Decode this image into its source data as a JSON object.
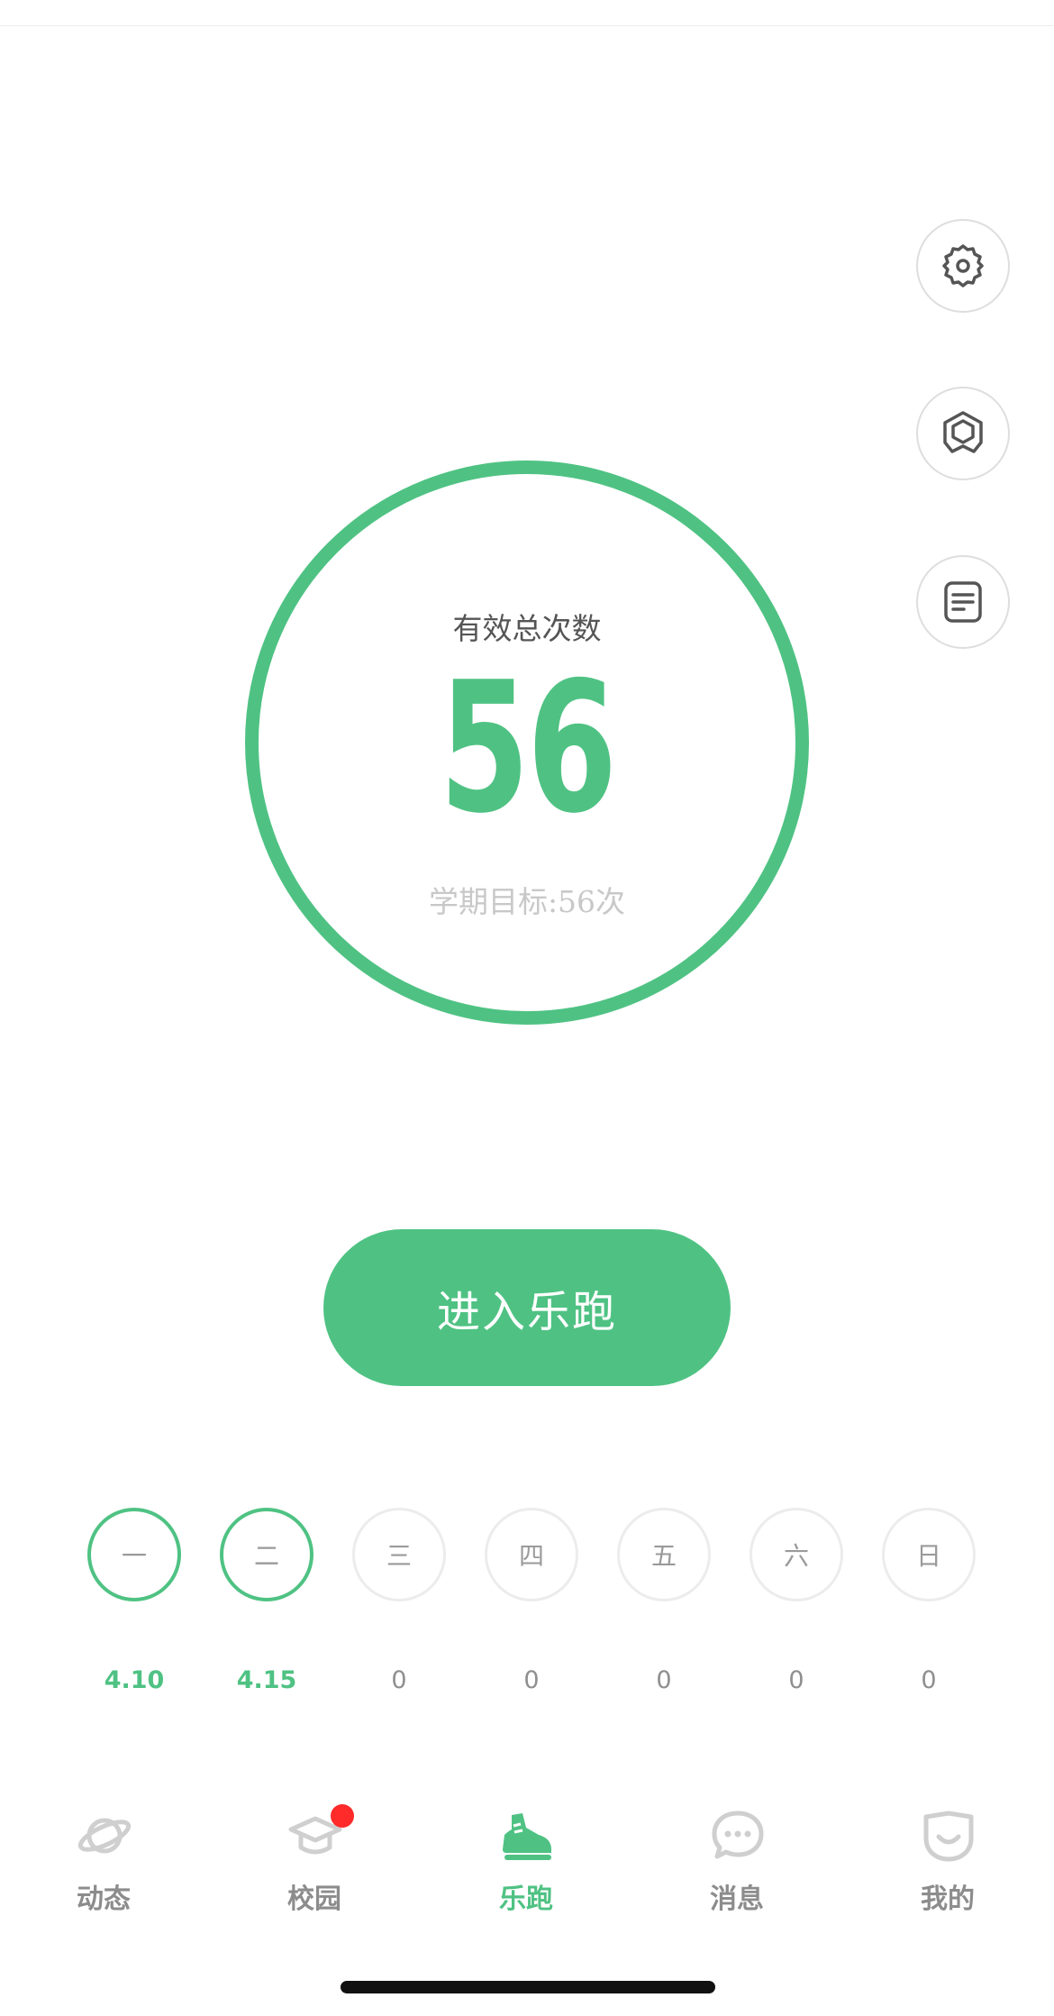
{
  "colors": {
    "accent": "#4fc283",
    "inactive": "#cfcfcf",
    "badge": "#ff2a2a"
  },
  "side_buttons": [
    {
      "icon": "gear-icon"
    },
    {
      "icon": "hexagon-badge-icon"
    },
    {
      "icon": "document-list-icon"
    }
  ],
  "progress": {
    "title": "有效总次数",
    "value": "56",
    "goal_text": "学期目标:56次",
    "fraction": 1.0
  },
  "enter_button": {
    "label": "进入乐跑"
  },
  "week": [
    {
      "day": "一",
      "count": "4.10",
      "done": true
    },
    {
      "day": "二",
      "count": "4.15",
      "done": true
    },
    {
      "day": "三",
      "count": "0",
      "done": false
    },
    {
      "day": "四",
      "count": "0",
      "done": false
    },
    {
      "day": "五",
      "count": "0",
      "done": false
    },
    {
      "day": "六",
      "count": "0",
      "done": false
    },
    {
      "day": "日",
      "count": "0",
      "done": false
    }
  ],
  "tabs": [
    {
      "label": "动态",
      "icon": "planet-icon",
      "active": false
    },
    {
      "label": "校园",
      "icon": "graduation-cap-icon",
      "active": false,
      "badge": true
    },
    {
      "label": "乐跑",
      "icon": "running-shoe-icon",
      "active": true
    },
    {
      "label": "消息",
      "icon": "chat-bubble-icon",
      "active": false
    },
    {
      "label": "我的",
      "icon": "smile-face-icon",
      "active": false
    }
  ]
}
